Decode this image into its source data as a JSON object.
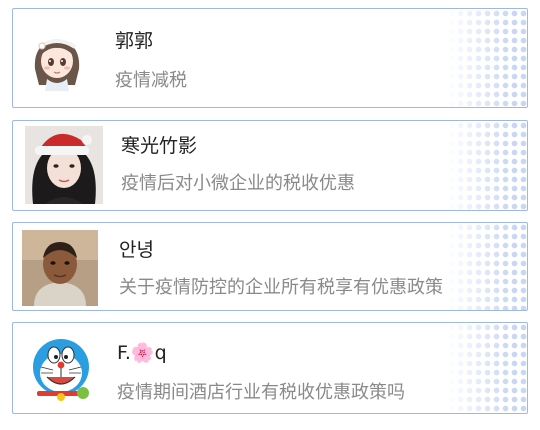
{
  "conversations": [
    {
      "name": "郭郭",
      "message": "疫情减税",
      "avatar_icon": "cartoon-girl-avatar-icon"
    },
    {
      "name": "寒光竹影",
      "message": "疫情后对小微企业的税收优惠",
      "avatar_icon": "girl-santa-hat-avatar-icon"
    },
    {
      "name": "안녕",
      "message": "关于疫情防控的企业所有税享有优惠政策",
      "avatar_icon": "boy-photo-avatar-icon"
    },
    {
      "name": "F.🌸q",
      "message": "疫情期间酒店行业有税收优惠政策吗",
      "avatar_icon": "doraemon-avatar-icon"
    }
  ],
  "colors": {
    "card_border": "#9fb6e6",
    "dot_pattern": "#c9d6f4",
    "name_text": "#222222",
    "message_text": "#8a8a8a"
  }
}
